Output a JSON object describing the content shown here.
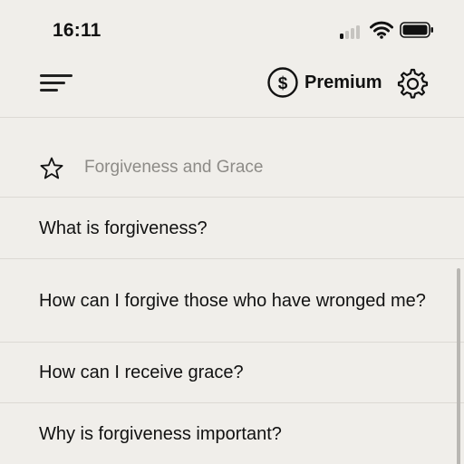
{
  "status_bar": {
    "time": "16:11"
  },
  "top_bar": {
    "premium_label": "Premium"
  },
  "section": {
    "title": "Forgiveness and Grace"
  },
  "questions": [
    "What is forgiveness?",
    "How can I forgive those who have wronged me?",
    "How can I receive grace?",
    "Why is forgiveness important?"
  ],
  "icons": {
    "menu": "hamburger-menu-icon",
    "premium": "dollar-circle-icon",
    "settings": "gear-icon",
    "favorite": "star-outline-icon"
  },
  "colors": {
    "background": "#f0eeea",
    "divider": "#dcd9d4",
    "muted_text": "#8d8b87",
    "text": "#111111"
  }
}
